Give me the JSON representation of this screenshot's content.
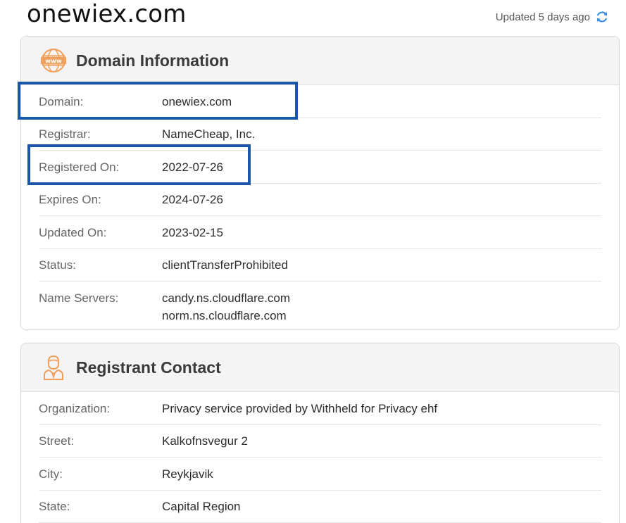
{
  "header": {
    "domain_title": "onewiex.com",
    "updated_text": "Updated 5 days ago",
    "refresh_icon": "refresh-icon"
  },
  "domain_info": {
    "title": "Domain Information",
    "icon": "www-icon",
    "rows": [
      {
        "label": "Domain:",
        "value": "onewiex.com"
      },
      {
        "label": "Registrar:",
        "value": "NameCheap, Inc."
      },
      {
        "label": "Registered On:",
        "value": "2022-07-26"
      },
      {
        "label": "Expires On:",
        "value": "2024-07-26"
      },
      {
        "label": "Updated On:",
        "value": "2023-02-15"
      },
      {
        "label": "Status:",
        "value": "clientTransferProhibited"
      },
      {
        "label": "Name Servers:",
        "values": [
          "candy.ns.cloudflare.com",
          "norm.ns.cloudflare.com"
        ]
      }
    ]
  },
  "registrant": {
    "title": "Registrant Contact",
    "icon": "person-icon",
    "rows": [
      {
        "label": "Organization:",
        "value": "Privacy service provided by Withheld for Privacy ehf"
      },
      {
        "label": "Street:",
        "value": "Kalkofnsvegur 2"
      },
      {
        "label": "City:",
        "value": "Reykjavik"
      },
      {
        "label": "State:",
        "value": "Capital Region"
      }
    ]
  },
  "colors": {
    "accent_orange": "#f0a05a",
    "highlight_blue": "#1a57a8",
    "refresh_blue": "#3a8ee6"
  }
}
